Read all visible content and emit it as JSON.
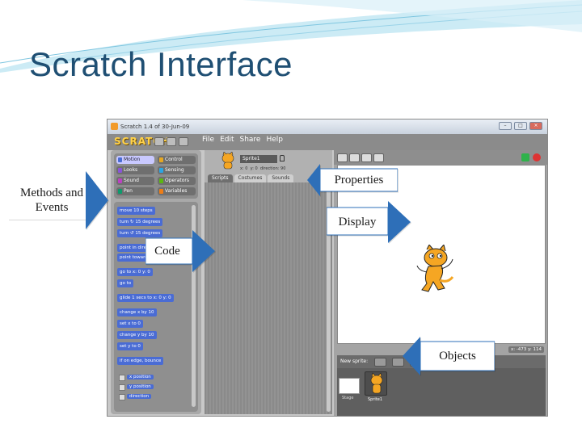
{
  "slide": {
    "title": "Scratch Interface"
  },
  "window": {
    "title": "Scratch 1.4 of 30-Jun-09",
    "logo": "SCRATCH",
    "menus": [
      "File",
      "Edit",
      "Share",
      "Help"
    ]
  },
  "categories": [
    {
      "label": "Motion",
      "color": "#4a6cd4"
    },
    {
      "label": "Control",
      "color": "#e6a822"
    },
    {
      "label": "Looks",
      "color": "#8a55d7"
    },
    {
      "label": "Sensing",
      "color": "#2ca5e2"
    },
    {
      "label": "Sound",
      "color": "#bb42c3"
    },
    {
      "label": "Operators",
      "color": "#5cb712"
    },
    {
      "label": "Pen",
      "color": "#0e9a6c"
    },
    {
      "label": "Variables",
      "color": "#ee7d16"
    }
  ],
  "blocks": [
    "move 10 steps",
    "turn ↻ 15 degrees",
    "turn ↺ 15 degrees",
    "point in direction 90",
    "point towards",
    "go to x: 0 y: 0",
    "go to",
    "glide 1 secs to x: 0 y: 0",
    "change x by 10",
    "set x to 0",
    "change y by 10",
    "set y to 0",
    "if on edge, bounce",
    "x position",
    "y position",
    "direction"
  ],
  "sprite": {
    "name": "Sprite1",
    "x": "x: 0",
    "y": "y: 0",
    "direction": "direction: 90"
  },
  "tabs": [
    "Scripts",
    "Costumes",
    "Sounds"
  ],
  "stage": {
    "mouse": "x: -473  y: 114",
    "new_sprite_label": "New sprite:",
    "stage_label": "Stage",
    "sprite_label": "Sprite1"
  },
  "callouts": {
    "methods": "Methods and Events",
    "properties": "Properties",
    "display": "Display",
    "code": "Code",
    "objects": "Objects"
  },
  "colors": {
    "title": "#1f4f73",
    "arrow_fill": "#2e6fb8",
    "label_box": "#ffffff",
    "cat": "#f29b2b"
  }
}
